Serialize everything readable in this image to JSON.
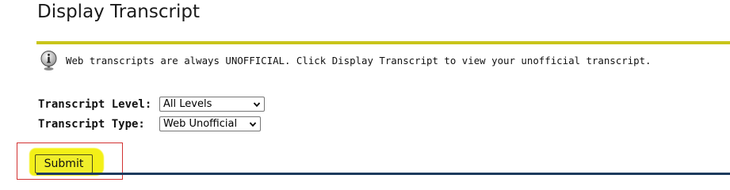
{
  "page": {
    "title": "Display Transcript"
  },
  "info": {
    "icon": "info-icon",
    "message": "Web transcripts are always UNOFFICIAL. Click Display Transcript to view your unofficial transcript."
  },
  "form": {
    "level": {
      "label": "Transcript Level:",
      "selected": "All Levels"
    },
    "type": {
      "label": "Transcript Type:",
      "selected": "Web Unofficial"
    },
    "submit_label": "Submit"
  },
  "colors": {
    "title_rule": "#c9c51a",
    "bottom_rule": "#1d3b5e",
    "highlight": "#f3f017",
    "annotation_box": "#d23232"
  }
}
